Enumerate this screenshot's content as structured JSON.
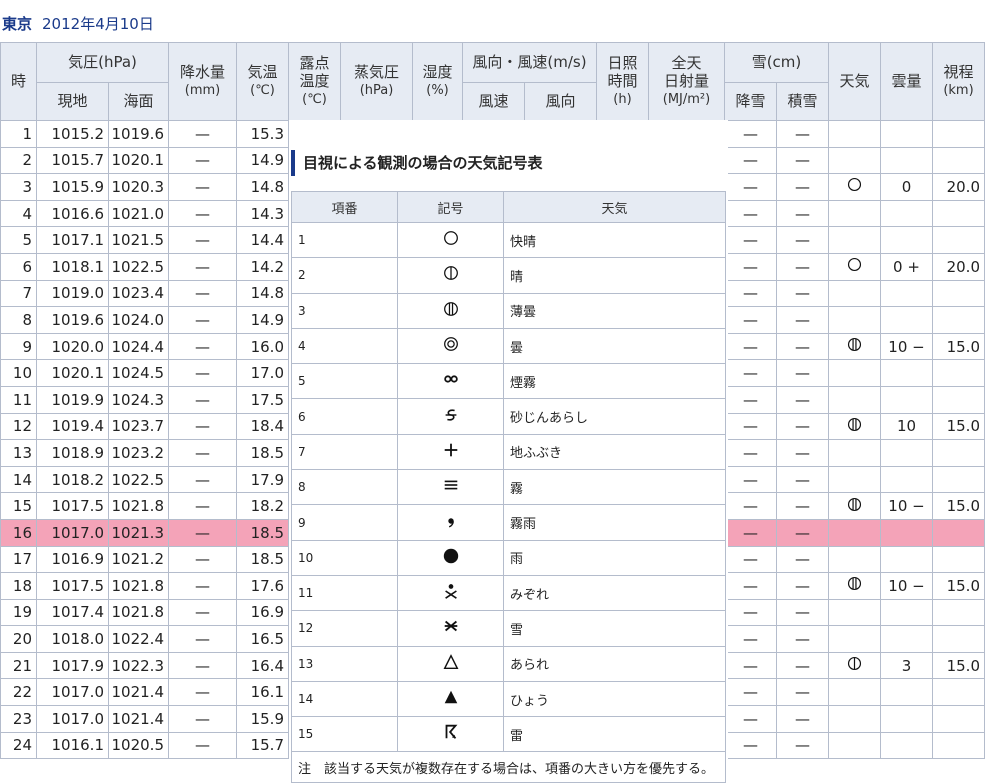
{
  "title": {
    "location": "東京",
    "date": "2012年4月10日"
  },
  "header": {
    "hour": "時",
    "pressure": "気圧(hPa)",
    "pressure_station": "現地",
    "pressure_sea": "海面",
    "precip": "降水量",
    "precip_unit": "(mm)",
    "temp": "気温",
    "temp_unit": "(℃)",
    "dew_a": "露点",
    "dew_b": "温度",
    "dew_c": "(℃)",
    "vapor": "蒸気圧",
    "vapor_unit": "(hPa)",
    "humidity": "湿度",
    "humidity_unit": "(%)",
    "wind": "風向・風速(m/s)",
    "wind_speed": "風速",
    "wind_dir": "風向",
    "sun_a": "日照",
    "sun_b": "時間",
    "sun_c": "(h)",
    "rad_a": "全天",
    "rad_b": "日射量",
    "rad_c": "(MJ/m²)",
    "snow": "雪(cm)",
    "snow_fall": "降雪",
    "snow_depth": "積雪",
    "weather": "天気",
    "cloud": "雲量",
    "visibility": "視程",
    "visibility_unit": "(km)"
  },
  "rows": [
    {
      "hour": "1",
      "pst": "1015.2",
      "psea": "1019.6",
      "precip": "—",
      "temp": "15.3",
      "sfall": "—",
      "sdepth": "—",
      "wx": "",
      "cloud": "",
      "vis": ""
    },
    {
      "hour": "2",
      "pst": "1015.7",
      "psea": "1020.1",
      "precip": "—",
      "temp": "14.9",
      "sfall": "—",
      "sdepth": "—",
      "wx": "",
      "cloud": "",
      "vis": ""
    },
    {
      "hour": "3",
      "pst": "1015.9",
      "psea": "1020.3",
      "precip": "—",
      "temp": "14.8",
      "sfall": "—",
      "sdepth": "—",
      "wx": "○",
      "cloud": "0",
      "vis": "20.0"
    },
    {
      "hour": "4",
      "pst": "1016.6",
      "psea": "1021.0",
      "precip": "—",
      "temp": "14.3",
      "sfall": "—",
      "sdepth": "—",
      "wx": "",
      "cloud": "",
      "vis": ""
    },
    {
      "hour": "5",
      "pst": "1017.1",
      "psea": "1021.5",
      "precip": "—",
      "temp": "14.4",
      "sfall": "—",
      "sdepth": "—",
      "wx": "",
      "cloud": "",
      "vis": ""
    },
    {
      "hour": "6",
      "pst": "1018.1",
      "psea": "1022.5",
      "precip": "—",
      "temp": "14.2",
      "sfall": "—",
      "sdepth": "—",
      "wx": "○",
      "cloud": "0 +",
      "vis": "20.0"
    },
    {
      "hour": "7",
      "pst": "1019.0",
      "psea": "1023.4",
      "precip": "—",
      "temp": "14.8",
      "sfall": "—",
      "sdepth": "—",
      "wx": "",
      "cloud": "",
      "vis": ""
    },
    {
      "hour": "8",
      "pst": "1019.6",
      "psea": "1024.0",
      "precip": "—",
      "temp": "14.9",
      "sfall": "—",
      "sdepth": "—",
      "wx": "",
      "cloud": "",
      "vis": ""
    },
    {
      "hour": "9",
      "pst": "1020.0",
      "psea": "1024.4",
      "precip": "—",
      "temp": "16.0",
      "sfall": "—",
      "sdepth": "—",
      "wx": "薄曇",
      "cloud": "10 −",
      "vis": "15.0"
    },
    {
      "hour": "10",
      "pst": "1020.1",
      "psea": "1024.5",
      "precip": "—",
      "temp": "17.0",
      "sfall": "—",
      "sdepth": "—",
      "wx": "",
      "cloud": "",
      "vis": ""
    },
    {
      "hour": "11",
      "pst": "1019.9",
      "psea": "1024.3",
      "precip": "—",
      "temp": "17.5",
      "sfall": "—",
      "sdepth": "—",
      "wx": "",
      "cloud": "",
      "vis": ""
    },
    {
      "hour": "12",
      "pst": "1019.4",
      "psea": "1023.7",
      "precip": "—",
      "temp": "18.4",
      "sfall": "—",
      "sdepth": "—",
      "wx": "薄曇",
      "cloud": "10",
      "vis": "15.0"
    },
    {
      "hour": "13",
      "pst": "1018.9",
      "psea": "1023.2",
      "precip": "—",
      "temp": "18.5",
      "sfall": "—",
      "sdepth": "—",
      "wx": "",
      "cloud": "",
      "vis": ""
    },
    {
      "hour": "14",
      "pst": "1018.2",
      "psea": "1022.5",
      "precip": "—",
      "temp": "17.9",
      "sfall": "—",
      "sdepth": "—",
      "wx": "",
      "cloud": "",
      "vis": ""
    },
    {
      "hour": "15",
      "pst": "1017.5",
      "psea": "1021.8",
      "precip": "—",
      "temp": "18.2",
      "sfall": "—",
      "sdepth": "—",
      "wx": "薄曇",
      "cloud": "10 −",
      "vis": "15.0"
    },
    {
      "hour": "16",
      "pst": "1017.0",
      "psea": "1021.3",
      "precip": "—",
      "temp": "18.5",
      "sfall": "—",
      "sdepth": "—",
      "wx": "",
      "cloud": "",
      "vis": "",
      "highlight": true
    },
    {
      "hour": "17",
      "pst": "1016.9",
      "psea": "1021.2",
      "precip": "—",
      "temp": "18.5",
      "sfall": "—",
      "sdepth": "—",
      "wx": "",
      "cloud": "",
      "vis": ""
    },
    {
      "hour": "18",
      "pst": "1017.5",
      "psea": "1021.8",
      "precip": "—",
      "temp": "17.6",
      "sfall": "—",
      "sdepth": "—",
      "wx": "薄曇",
      "cloud": "10 −",
      "vis": "15.0"
    },
    {
      "hour": "19",
      "pst": "1017.4",
      "psea": "1021.8",
      "precip": "—",
      "temp": "16.9",
      "sfall": "—",
      "sdepth": "—",
      "wx": "",
      "cloud": "",
      "vis": ""
    },
    {
      "hour": "20",
      "pst": "1018.0",
      "psea": "1022.4",
      "precip": "—",
      "temp": "16.5",
      "sfall": "—",
      "sdepth": "—",
      "wx": "",
      "cloud": "",
      "vis": ""
    },
    {
      "hour": "21",
      "pst": "1017.9",
      "psea": "1022.3",
      "precip": "—",
      "temp": "16.4",
      "sfall": "—",
      "sdepth": "—",
      "wx": "晴",
      "cloud": "3",
      "vis": "15.0"
    },
    {
      "hour": "22",
      "pst": "1017.0",
      "psea": "1021.4",
      "precip": "—",
      "temp": "16.1",
      "sfall": "—",
      "sdepth": "—",
      "wx": "",
      "cloud": "",
      "vis": ""
    },
    {
      "hour": "23",
      "pst": "1017.0",
      "psea": "1021.4",
      "precip": "—",
      "temp": "15.9",
      "sfall": "—",
      "sdepth": "—",
      "wx": "",
      "cloud": "",
      "vis": ""
    },
    {
      "hour": "24",
      "pst": "1016.1",
      "psea": "1020.5",
      "precip": "—",
      "temp": "15.7",
      "sfall": "—",
      "sdepth": "—",
      "wx": "",
      "cloud": "",
      "vis": ""
    }
  ],
  "legend": {
    "title": "目視による観測の場合の天気記号表",
    "col_no": "項番",
    "col_symbol": "記号",
    "col_weather": "天気",
    "items": [
      {
        "no": "1",
        "icon": "clear-circle",
        "weather": "快晴"
      },
      {
        "no": "2",
        "icon": "circle-one-bar",
        "weather": "晴"
      },
      {
        "no": "3",
        "icon": "circle-two-bars",
        "weather": "薄曇"
      },
      {
        "no": "4",
        "icon": "double-circle",
        "weather": "曇"
      },
      {
        "no": "5",
        "icon": "infinity",
        "weather": "煙霧"
      },
      {
        "no": "6",
        "icon": "s-arrow",
        "weather": "砂じんあらし"
      },
      {
        "no": "7",
        "icon": "plus",
        "weather": "地ふぶき"
      },
      {
        "no": "8",
        "icon": "triple-bar",
        "weather": "霧"
      },
      {
        "no": "9",
        "icon": "comma",
        "weather": "霧雨"
      },
      {
        "no": "10",
        "icon": "filled-circle",
        "weather": "雨"
      },
      {
        "no": "11",
        "icon": "rain-snow",
        "weather": "みぞれ"
      },
      {
        "no": "12",
        "icon": "snow-cross",
        "weather": "雪"
      },
      {
        "no": "13",
        "icon": "open-triangle",
        "weather": "あられ"
      },
      {
        "no": "14",
        "icon": "filled-triangle",
        "weather": "ひょう"
      },
      {
        "no": "15",
        "icon": "thunder",
        "weather": "雷"
      }
    ],
    "note": "注　該当する天気が複数存在する場合は、項番の大きい方を優先する。"
  },
  "colors": {
    "header_bg": "#e6ebf3",
    "border": "#b4bccc",
    "highlight": "#f4a3b8",
    "title": "#1a3a8a"
  }
}
